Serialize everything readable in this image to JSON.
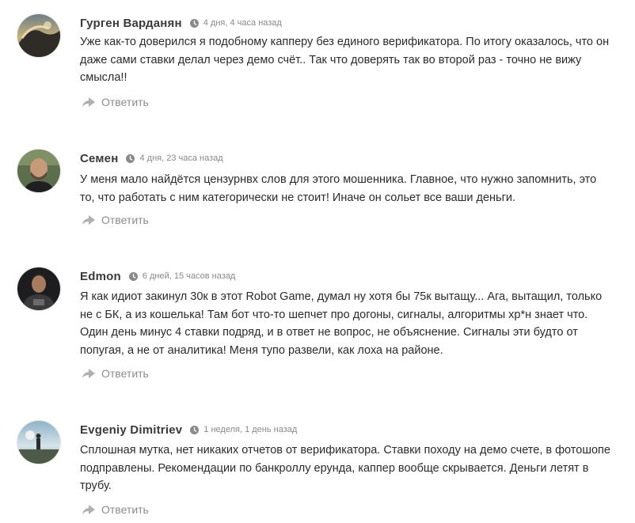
{
  "comments": [
    {
      "author": "Гурген Варданян",
      "time": "4 дня, 4 часа назад",
      "text": "Уже как-то доверился я подобному капперу без единого верификатора. По итогу оказалось, что он даже сами ставки делал через демо счёт.. Так что доверять так во второй раз - точно не вижу смысла!!",
      "reply_label": "Ответить"
    },
    {
      "author": "Семен",
      "time": "4 дня, 23 часа назад",
      "text": "У меня мало найдётся цензурнвх слов для этого мошенника. Главное, что нужно запомнить, это то, что работать с ним категорически не стоит! Иначе он сольет все ваши деньги.",
      "reply_label": "Ответить"
    },
    {
      "author": "Edmon",
      "time": "6 дней, 15 часов назад",
      "text": "Я как идиот закинул 30к в этот Robot Game, думал ну хотя бы 75к вытащу... Ага, вытащил, только не с БК, а из кошелька! Там бот что-то шепчет про догоны, сигналы, алгоритмы хр*н знает что. Один день минус 4 ставки подряд, и в ответ не вопрос, не объяснение. Сигналы эти будто от попугая, а не от аналитика! Меня тупо развели, как лоха на районе.",
      "reply_label": "Ответить"
    },
    {
      "author": "Evgeniy Dimitriev",
      "time": "1 неделя, 1 день назад",
      "text": "Сплошная мутка, нет никаких отчетов от верификатора. Ставки походу на демо счете, в фотошопе подправлены. Рекомендации по банкроллу ерунда, каппер вообще скрывается. Деньги летят в трубу.",
      "reply_label": "Ответить"
    }
  ],
  "icons": {
    "time": "clock-icon",
    "reply": "reply-arrow-icon"
  },
  "colors": {
    "author": "#3a3a3a",
    "meta": "#8a8a8a",
    "reply": "#8c8c8c",
    "text": "#2b2b2b"
  }
}
